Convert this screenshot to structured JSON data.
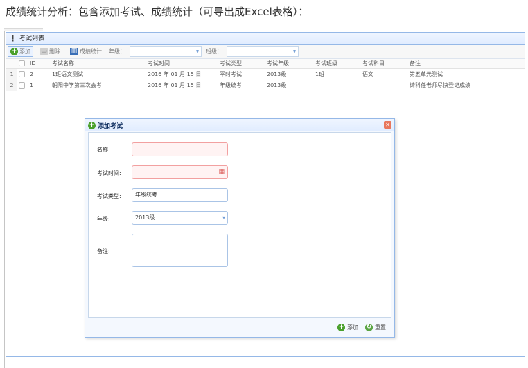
{
  "caption": "成绩统计分析：包含添加考试、成绩统计（可导出成Excel表格）：",
  "panel": {
    "title": "考试列表",
    "toolbar": {
      "add": "添加",
      "delete": "删除",
      "stats": "成绩统计",
      "grade_label": "年级：",
      "class_label": "班级：",
      "grade_value": "",
      "class_value": ""
    }
  },
  "grid": {
    "columns": [
      "ID",
      "考试名称",
      "考试时间",
      "考试类型",
      "考试年级",
      "考试班级",
      "考试科目",
      "备注"
    ],
    "rows": [
      {
        "num": "1",
        "id": "2",
        "name": "1班语文测试",
        "time": "2016 年 01 月 15 日",
        "type": "平时考试",
        "grade": "2013级",
        "class": "1班",
        "subject": "语文",
        "note": "第五单元测试"
      },
      {
        "num": "2",
        "id": "1",
        "name": "朝阳中学第三次会考",
        "time": "2016 年 01 月 15 日",
        "type": "年级统考",
        "grade": "2013级",
        "class": "",
        "subject": "",
        "note": "请科任老师尽快登记成绩"
      }
    ]
  },
  "dialog": {
    "title": "添加考试",
    "labels": {
      "name": "名称:",
      "time": "考试时间:",
      "type": "考试类型:",
      "grade": "年级:",
      "note": "备注:"
    },
    "values": {
      "name": "",
      "time": "",
      "type": "年级统考",
      "grade": "2013级",
      "note": ""
    },
    "buttons": {
      "add": "添加",
      "reset": "重置"
    }
  },
  "icons": {
    "add": "plus-circle-icon",
    "delete": "trash-icon",
    "stats": "bar-chart-icon",
    "close": "close-icon",
    "calendar": "calendar-icon",
    "dropdown": "chevron-down-icon",
    "reset": "reload-icon"
  }
}
